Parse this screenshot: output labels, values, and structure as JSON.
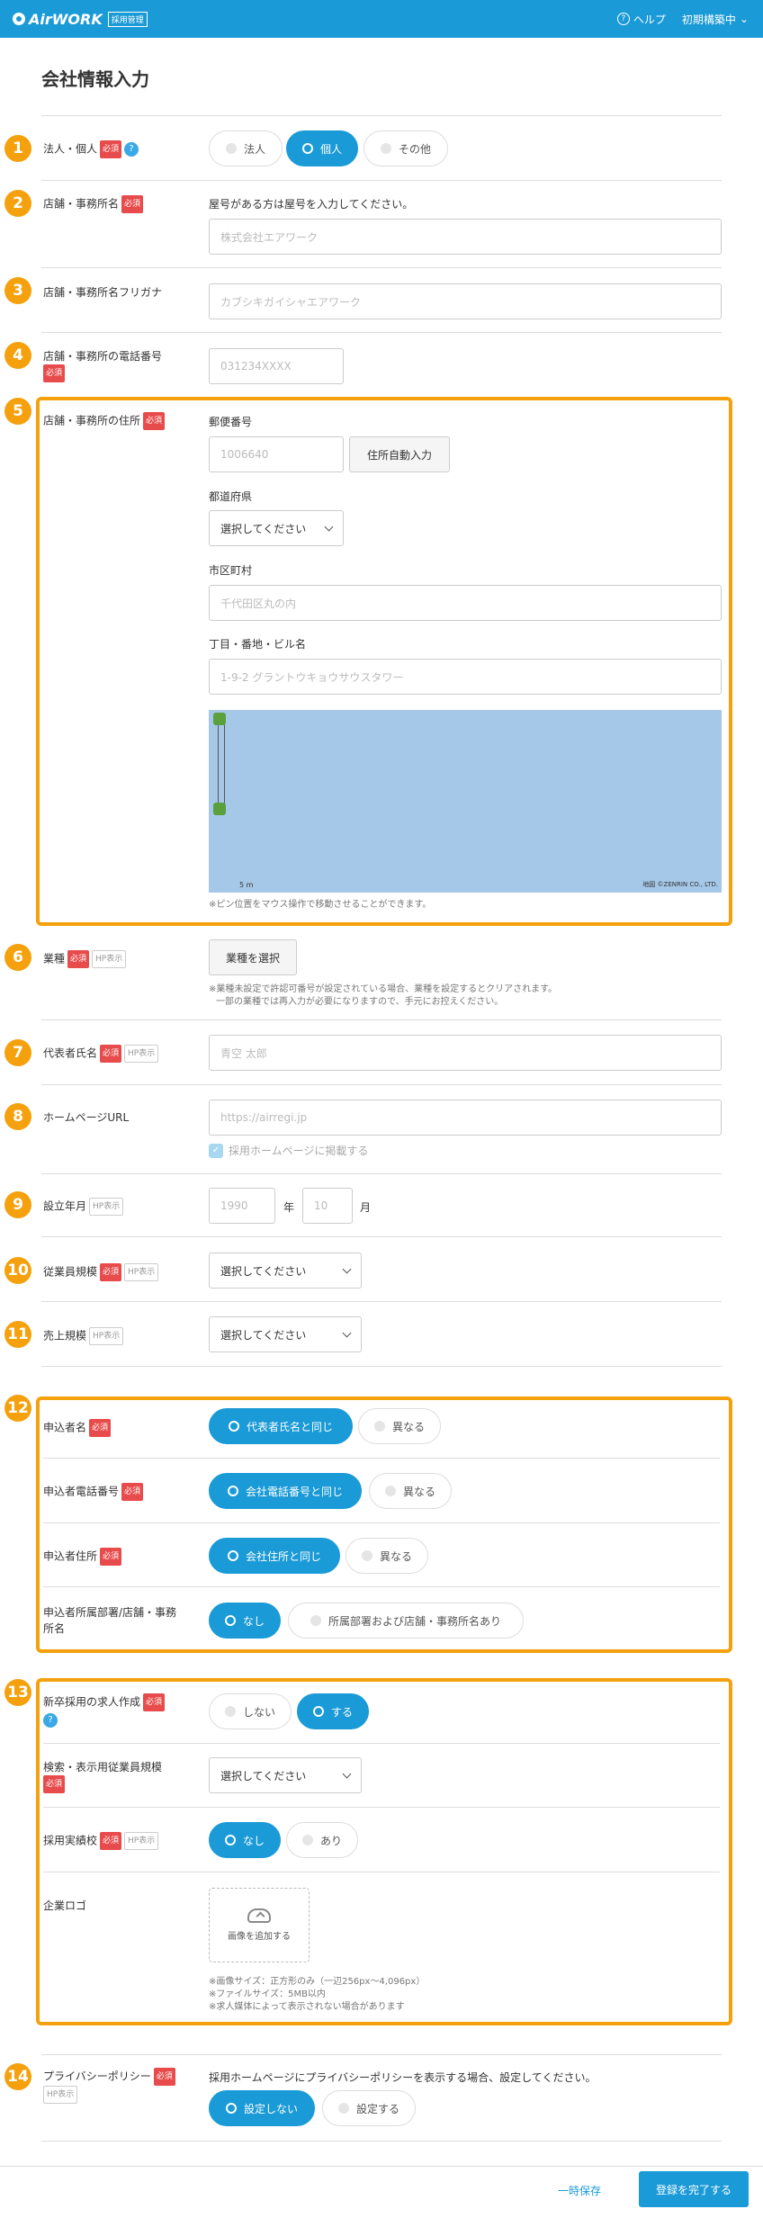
{
  "header": {
    "logo": "AirWORK",
    "logo_tag": "採用管理",
    "help": "ヘルプ",
    "menu": "初期構築中"
  },
  "page_title": "会社情報入力",
  "labels": {
    "required": "必須",
    "hp": "HP表示",
    "s1": "法人・個人",
    "s2": "店舗・事務所名",
    "s3": "店舗・事務所名フリガナ",
    "s4": "店舗・事務所の電話番号",
    "s5": "店舗・事務所の住所",
    "s6": "業種",
    "s7": "代表者氏名",
    "s8": "ホームページURL",
    "s9": "設立年月",
    "s10": "従業員規模",
    "s11": "売上規模",
    "s12a": "申込者名",
    "s12b": "申込者電話番号",
    "s12c": "申込者住所",
    "s12d1": "申込者所属部署/店舗・事務",
    "s12d2": "所名",
    "s13a": "新卒採用の求人作成",
    "s13b": "検索・表示用従業員規模",
    "s13c": "採用実績校",
    "s13d": "企業ロゴ",
    "s14": "プライバシーポリシー"
  },
  "numbers": [
    "1",
    "2",
    "3",
    "4",
    "5",
    "6",
    "7",
    "8",
    "9",
    "10",
    "11",
    "12",
    "13",
    "14"
  ],
  "s1": {
    "opts": [
      "法人",
      "個人",
      "その他"
    ]
  },
  "s2": {
    "hint": "屋号がある方は屋号を入力してください。",
    "placeholder": "株式会社エアワーク"
  },
  "s3": {
    "placeholder": "カブシキガイシャエアワーク"
  },
  "s4": {
    "placeholder": "031234XXXX"
  },
  "s5": {
    "postal_label": "郵便番号",
    "postal_ph": "1006640",
    "auto_btn": "住所自動入力",
    "pref_label": "都道府県",
    "pref_val": "選択してください",
    "city_label": "市区町村",
    "city_ph": "千代田区丸の内",
    "street_label": "丁目・番地・ビル名",
    "street_ph": "1-9-2 グラントウキョウサウスタワー",
    "map_scale": "5 m",
    "map_copy": "地図 ©ZENRIN CO., LTD.",
    "pin_note": "※ピン位置をマウス操作で移動させることができます。"
  },
  "s6": {
    "btn": "業種を選択",
    "note1": "※業種未設定で許認可番号が設定されている場合、業種を設定するとクリアされます。",
    "note2": "一部の業種では再入力が必要になりますので、手元にお控えください。"
  },
  "s7": {
    "placeholder": "青空 太郎"
  },
  "s8": {
    "placeholder": "https://airregi.jp",
    "check": "採用ホームページに掲載する"
  },
  "s9": {
    "year_ph": "1990",
    "year": "年",
    "month_ph": "10",
    "month": "月"
  },
  "s10": {
    "val": "選択してください"
  },
  "s11": {
    "val": "選択してください"
  },
  "s12": {
    "a": [
      "代表者氏名と同じ",
      "異なる"
    ],
    "b": [
      "会社電話番号と同じ",
      "異なる"
    ],
    "c": [
      "会社住所と同じ",
      "異なる"
    ],
    "d": [
      "なし",
      "所属部署および店舗・事務所名あり"
    ]
  },
  "s13": {
    "a": [
      "しない",
      "する"
    ],
    "b": "選択してください",
    "c": [
      "なし",
      "あり"
    ],
    "upload": "画像を追加する",
    "n1": "※画像サイズ：正方形のみ（一辺256px〜4,096px）",
    "n2": "※ファイルサイズ：5MB以内",
    "n3": "※求人媒体によって表示されない場合があります"
  },
  "s14": {
    "desc": "採用ホームページにプライバシーポリシーを表示する場合、設定してください。",
    "opts": [
      "設定しない",
      "設定する"
    ]
  },
  "footer": {
    "save": "一時保存",
    "done": "登録を完了する"
  }
}
